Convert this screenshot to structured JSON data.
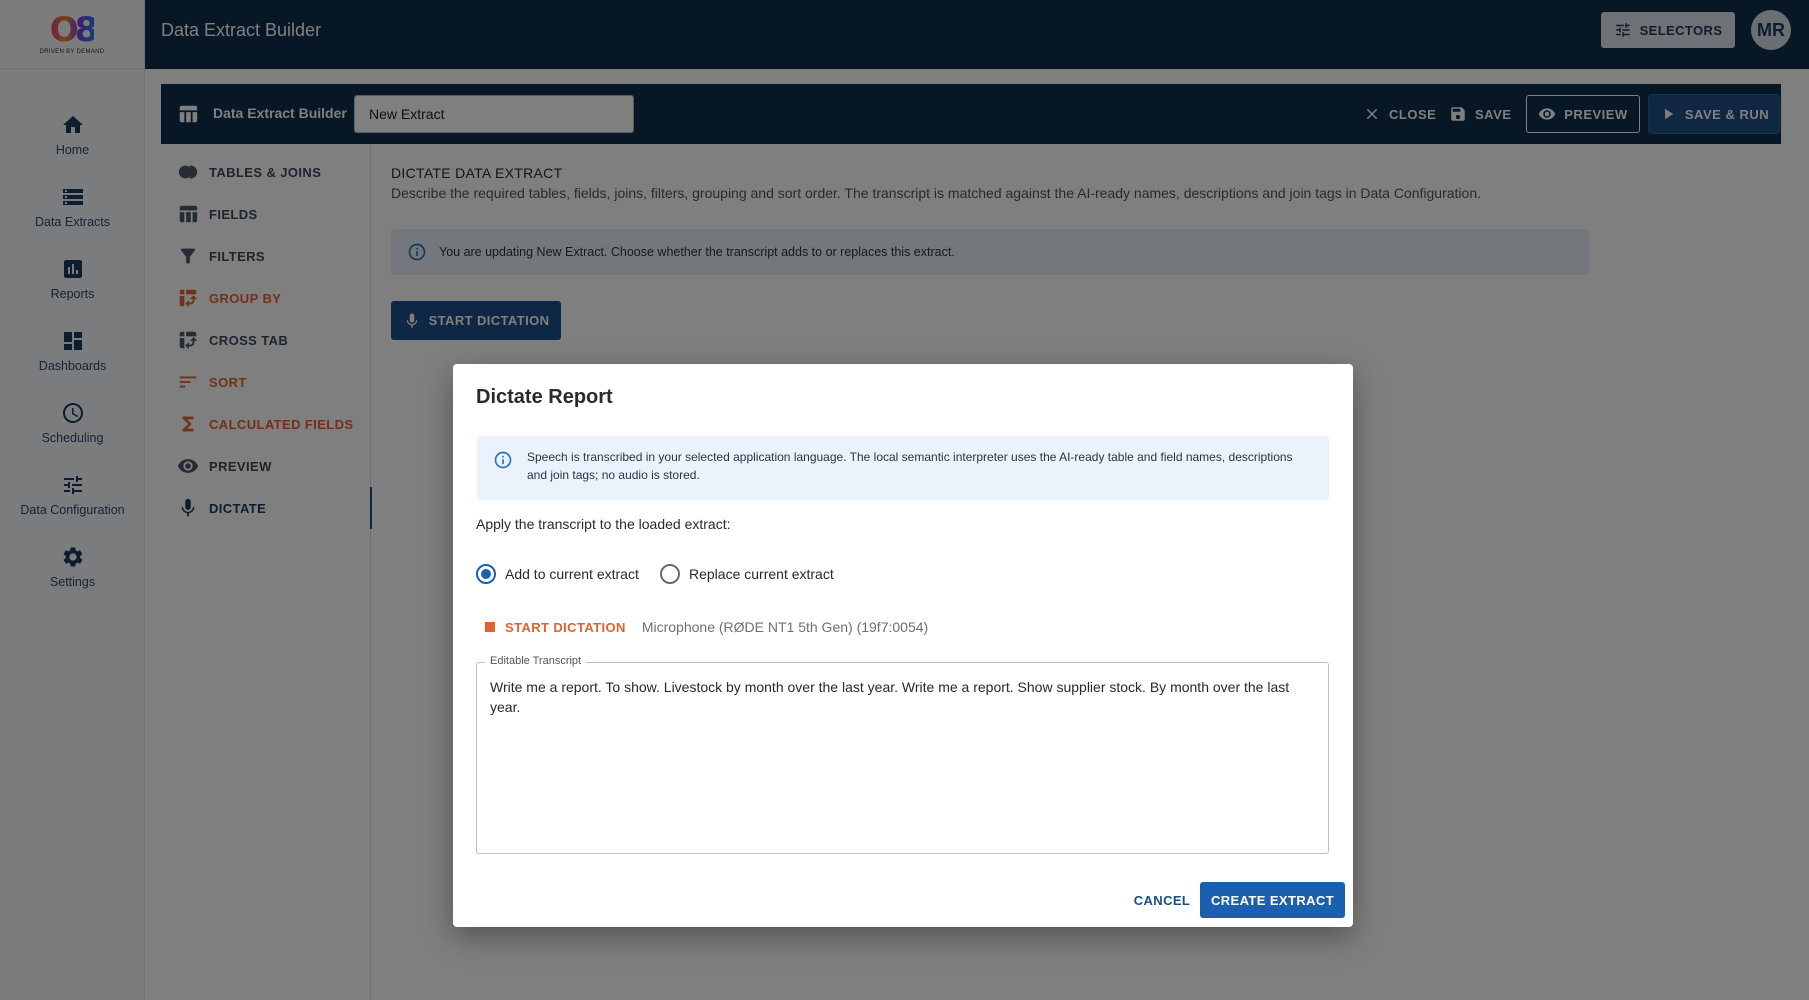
{
  "app": {
    "title": "Data Extract Builder",
    "logo_mark": "O8",
    "logo_tagline": "DRIVEN BY DEMAND",
    "selectors_label": "SELECTORS",
    "avatar_initials": "MR"
  },
  "nav": {
    "items": [
      {
        "label": "Home",
        "icon": "home-icon"
      },
      {
        "label": "Data Extracts",
        "icon": "data-extracts-icon"
      },
      {
        "label": "Reports",
        "icon": "reports-icon"
      },
      {
        "label": "Dashboards",
        "icon": "dashboards-icon"
      },
      {
        "label": "Scheduling",
        "icon": "clock-icon"
      },
      {
        "label": "Data Configuration",
        "icon": "tune-icon"
      },
      {
        "label": "Settings",
        "icon": "gear-icon"
      }
    ]
  },
  "builder": {
    "title": "Data Extract Builder",
    "extract_name": "New Extract",
    "close_label": "CLOSE",
    "save_label": "SAVE",
    "preview_label": "PREVIEW",
    "save_run_label": "SAVE & RUN"
  },
  "tabs": {
    "items": [
      {
        "label": "TABLES & JOINS",
        "icon": "tables-joins-icon",
        "style": "normal"
      },
      {
        "label": "FIELDS",
        "icon": "table-icon",
        "style": "normal"
      },
      {
        "label": "FILTERS",
        "icon": "filter-icon",
        "style": "normal"
      },
      {
        "label": "GROUP BY",
        "icon": "pivot-icon",
        "style": "orange"
      },
      {
        "label": "CROSS TAB",
        "icon": "pivot-icon",
        "style": "normal"
      },
      {
        "label": "SORT",
        "icon": "sort-icon",
        "style": "orange"
      },
      {
        "label": "CALCULATED FIELDS",
        "icon": "sigma-icon",
        "style": "orange"
      },
      {
        "label": "PREVIEW",
        "icon": "eye-icon",
        "style": "normal"
      },
      {
        "label": "DICTATE",
        "icon": "mic-icon",
        "style": "active"
      }
    ]
  },
  "content": {
    "title": "DICTATE DATA EXTRACT",
    "description": "Describe the required tables, fields, joins, filters, grouping and sort order. The transcript is matched against the AI-ready names, descriptions and join tags in Data Configuration.",
    "info": "You are updating New Extract. Choose whether the transcript adds to or replaces this extract.",
    "start_dictation_label": "START DICTATION"
  },
  "dialog": {
    "title": "Dictate Report",
    "info": "Speech is transcribed in your selected application language. The local semantic interpreter uses the AI-ready table and field names, descriptions and join tags; no audio is stored.",
    "apply_label": "Apply the transcript to the loaded extract:",
    "option_add": "Add to current extract",
    "option_replace": "Replace current extract",
    "selected_option": "Add to current extract",
    "dictation_status": "START DICTATION",
    "microphone": "Microphone (RØDE NT1 5th Gen) (19f7:0054)",
    "transcript_label": "Editable Transcript",
    "transcript": "Write me a report. To show. Livestock by month over the last year. Write me a report. Show supplier stock. By month over the last year.",
    "cancel_label": "CANCEL",
    "create_label": "CREATE EXTRACT"
  },
  "colors": {
    "navy": "#0f2f4b",
    "primary_blue": "#1b5fb0",
    "accent_orange": "#e2622e",
    "info_bg": "#eaf3fb"
  }
}
